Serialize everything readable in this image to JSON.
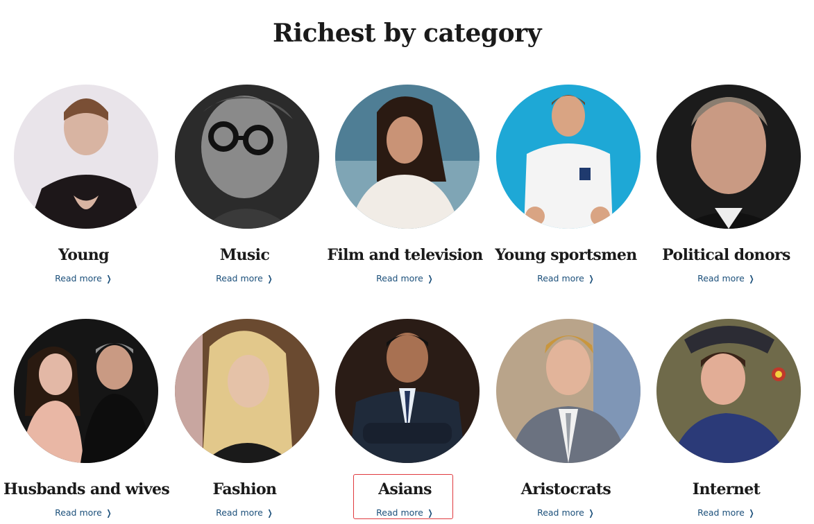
{
  "section": {
    "title": "Richest by category"
  },
  "categories": [
    {
      "label": "Young",
      "link": "Read more",
      "icon": "chevron-right-icon",
      "bg": "#e9e4ea",
      "fg": "#2a2226"
    },
    {
      "label": "Music",
      "link": "Read more",
      "icon": "chevron-right-icon",
      "bg": "#2b2b2b",
      "fg": "#8a8a8a"
    },
    {
      "label": "Film and television",
      "link": "Read more",
      "icon": "chevron-right-icon",
      "bg": "#4f7e95",
      "fg": "#f1ece6"
    },
    {
      "label": "Young sportsmen",
      "link": "Read more",
      "icon": "chevron-right-icon",
      "bg": "#1ea8d6",
      "fg": "#f4f4f4"
    },
    {
      "label": "Political donors",
      "link": "Read more",
      "icon": "chevron-right-icon",
      "bg": "#1b1b1b",
      "fg": "#c99a83"
    },
    {
      "label": "Husbands and wives",
      "link": "Read more",
      "icon": "chevron-right-icon",
      "bg": "#151515",
      "fg": "#e3b8a6"
    },
    {
      "label": "Fashion",
      "link": "Read more",
      "icon": "chevron-right-icon",
      "bg": "#6a4a30",
      "fg": "#e2c88b"
    },
    {
      "label": "Asians",
      "link": "Read more",
      "icon": "chevron-right-icon",
      "bg": "#2a1c16",
      "fg": "#1f2a3a"
    },
    {
      "label": "Aristocrats",
      "link": "Read more",
      "icon": "chevron-right-icon",
      "bg": "#b9a48a",
      "fg": "#6b7280"
    },
    {
      "label": "Internet",
      "link": "Read more",
      "icon": "chevron-right-icon",
      "bg": "#6f6a4a",
      "fg": "#2b3a78"
    }
  ],
  "colors": {
    "link": "#1b4f7a",
    "heading": "#1a1a1a",
    "highlight": "#e0393e"
  }
}
